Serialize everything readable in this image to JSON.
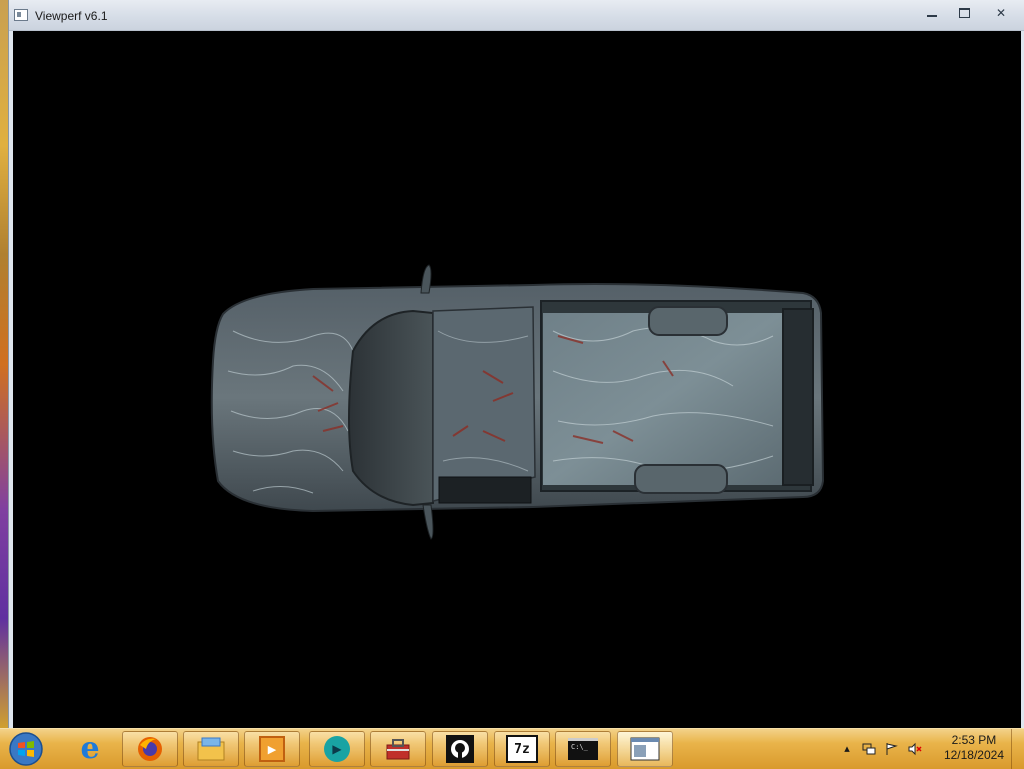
{
  "window": {
    "title": "Viewperf v6.1",
    "controls": {
      "minimize": "▭",
      "maximize": "☐",
      "close": "✕"
    }
  },
  "viewport": {
    "content": "textured-pickup-truck-top-view",
    "background": "#000000"
  },
  "taskbar": {
    "start_icon": "windows-logo-icon",
    "items": [
      {
        "name": "internet-explorer-icon",
        "label": "e",
        "color": "#1e7ad8"
      },
      {
        "name": "firefox-icon",
        "label": "",
        "color": "#e66000"
      },
      {
        "name": "file-explorer-icon",
        "label": "",
        "color": "#f2c24b"
      },
      {
        "name": "media-player-icon",
        "label": "▶",
        "color": "#e07a1a"
      },
      {
        "name": "teal-app-icon",
        "label": "▶",
        "color": "#19a3a3"
      },
      {
        "name": "toolbox-icon",
        "label": "",
        "color": "#c0302a"
      },
      {
        "name": "github-icon",
        "label": "",
        "color": "#111111"
      },
      {
        "name": "7zip-icon",
        "label": "7z",
        "color": "#111111"
      },
      {
        "name": "command-prompt-icon",
        "label": "C:\\_",
        "color": "#111111"
      },
      {
        "name": "viewperf-window-icon",
        "label": "",
        "color": "#ffffff"
      }
    ],
    "tray": {
      "icons": [
        "show-hidden-icons-icon",
        "network-icon",
        "action-center-flag-icon",
        "volume-muted-icon"
      ],
      "time": "2:53 PM",
      "date": "12/18/2024"
    }
  }
}
